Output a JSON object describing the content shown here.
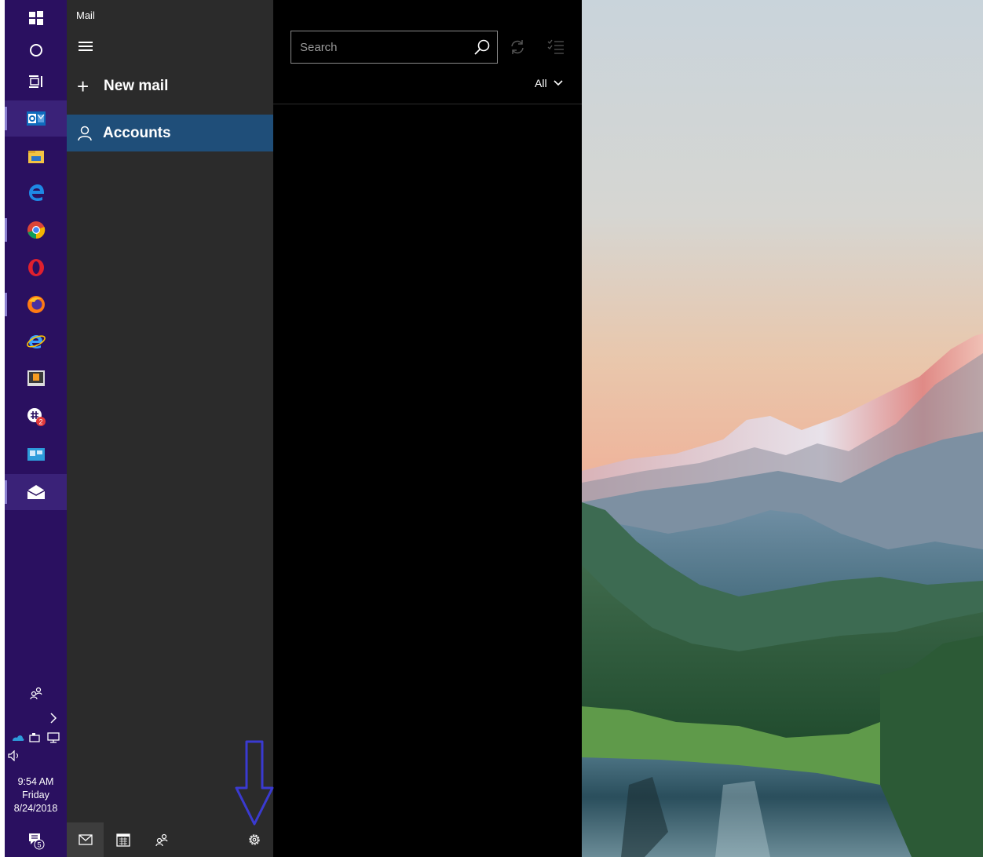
{
  "app": {
    "title": "Mail"
  },
  "nav": {
    "new_mail_label": "New mail",
    "accounts_label": "Accounts"
  },
  "search": {
    "placeholder": "Search"
  },
  "filter": {
    "label": "All"
  },
  "clock": {
    "time": "9:54 AM",
    "day": "Friday",
    "date": "8/24/2018"
  },
  "notifications": {
    "count": "5"
  },
  "taskbar": {
    "apps": [
      "start-icon",
      "cortana-icon",
      "task-view-icon",
      "outlook-icon",
      "file-explorer-icon",
      "edge-icon",
      "chrome-icon",
      "opera-icon",
      "firefox-icon",
      "internet-explorer-icon",
      "sublime-text-icon",
      "slack-icon",
      "remote-desktop-icon",
      "mail-icon"
    ]
  },
  "colors": {
    "taskbar": "#2a1060",
    "nav_pane": "#2b2b2b",
    "selected": "#1f4e79",
    "arrow": "#3a3ad0"
  }
}
